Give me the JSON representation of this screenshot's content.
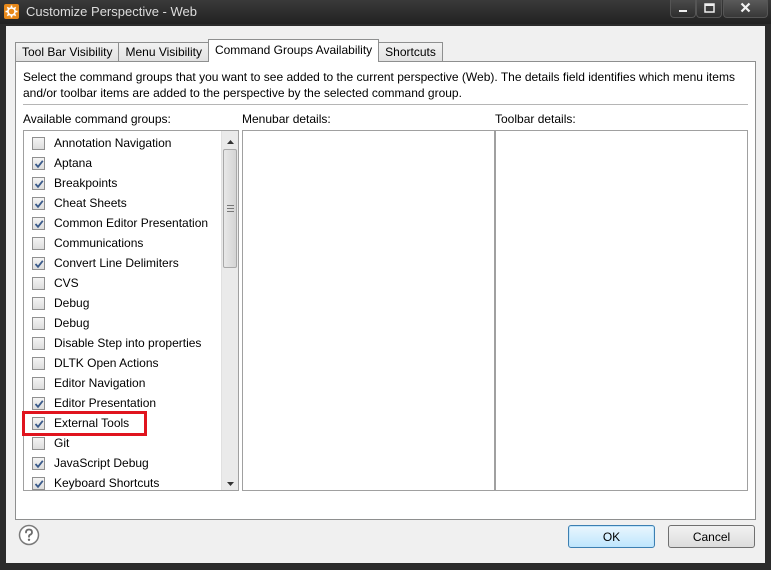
{
  "window": {
    "title": "Customize Perspective - Web",
    "icon": "gear-icon",
    "accent": "#e8891a"
  },
  "tabs": [
    {
      "label": "Tool Bar Visibility",
      "active": false
    },
    {
      "label": "Menu Visibility",
      "active": false
    },
    {
      "label": "Command Groups Availability",
      "active": true
    },
    {
      "label": "Shortcuts",
      "active": false
    }
  ],
  "description": "Select the command groups that you want to see added to the current perspective (Web).  The details field identifies which menu items and/or toolbar items are added to the perspective by the selected command group.",
  "columns": {
    "available": "Available command groups:",
    "menubar": "Menubar details:",
    "toolbar": "Toolbar details:"
  },
  "command_groups": [
    {
      "label": "Annotation Navigation",
      "checked": false
    },
    {
      "label": "Aptana",
      "checked": true
    },
    {
      "label": "Breakpoints",
      "checked": true
    },
    {
      "label": "Cheat Sheets",
      "checked": true
    },
    {
      "label": "Common Editor Presentation",
      "checked": true
    },
    {
      "label": "Communications",
      "checked": false
    },
    {
      "label": "Convert Line Delimiters",
      "checked": true
    },
    {
      "label": "CVS",
      "checked": false
    },
    {
      "label": "Debug",
      "checked": false
    },
    {
      "label": "Debug",
      "checked": false
    },
    {
      "label": "Disable Step into properties",
      "checked": false
    },
    {
      "label": "DLTK Open Actions",
      "checked": false
    },
    {
      "label": "Editor Navigation",
      "checked": false
    },
    {
      "label": "Editor Presentation",
      "checked": true
    },
    {
      "label": "External Tools",
      "checked": true
    },
    {
      "label": "Git",
      "checked": false
    },
    {
      "label": "JavaScript Debug",
      "checked": true
    },
    {
      "label": "Keyboard Shortcuts",
      "checked": true
    }
  ],
  "highlight_color": "#e0141e",
  "buttons": {
    "ok": "OK",
    "cancel": "Cancel"
  }
}
